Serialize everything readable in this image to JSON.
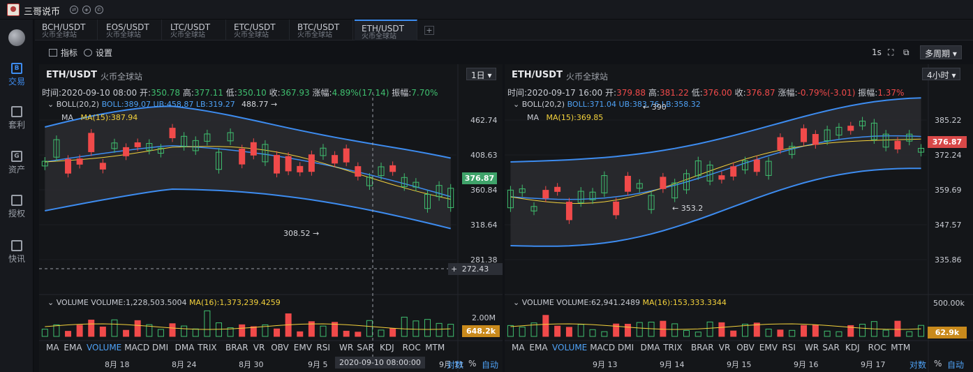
{
  "app": {
    "title": "三哥说币"
  },
  "sidebar": {
    "items": [
      {
        "label": "交易",
        "glyph": "B",
        "active": true
      },
      {
        "label": "套利",
        "glyph": "",
        "active": false
      },
      {
        "label": "资产",
        "glyph": "G",
        "active": false
      },
      {
        "label": "授权",
        "glyph": "",
        "active": false
      },
      {
        "label": "快讯",
        "glyph": "",
        "active": false
      }
    ]
  },
  "tabs": [
    {
      "name": "BCH/USDT",
      "sub": "火币全球站"
    },
    {
      "name": "EOS/USDT",
      "sub": "火币全球站"
    },
    {
      "name": "LTC/USDT",
      "sub": "火币全球站"
    },
    {
      "name": "ETC/USDT",
      "sub": "火币全球站"
    },
    {
      "name": "BTC/USDT",
      "sub": "火币全球站"
    },
    {
      "name": "ETH/USDT",
      "sub": "火币全球站",
      "active": true
    }
  ],
  "toolbar": {
    "indicators": "指标",
    "settings": "设置",
    "interval": "1s",
    "multi_period": "多周期"
  },
  "colors": {
    "up": "#3fbf6f",
    "down": "#f04a4a",
    "boll": "#4ea1f5",
    "ma": "#f4d23c",
    "accent": "#3d8cf0"
  },
  "left": {
    "symbol": "ETH/USDT",
    "exchange": "火币全球站",
    "period": "1日",
    "ohlc": {
      "time_label": "时间:",
      "time": "2020-09-10 08:00",
      "open_label": "开:",
      "open": "350.78",
      "high_label": "高:",
      "high": "377.11",
      "low_label": "低:",
      "low": "350.10",
      "close_label": "收:",
      "close": "367.93",
      "chg_label": "涨幅:",
      "chg": "4.89%(17.14)",
      "amp_label": "振幅:",
      "amp": "7.70%"
    },
    "boll": {
      "name": "BOLL(20,2)",
      "mid": "BOLL:389.07",
      "ub": "UB:458.87",
      "lb": "LB:319.27"
    },
    "ma": {
      "name": "MA",
      "value": "MA(15):387.94"
    },
    "volume": {
      "name": "VOLUME",
      "value": "VOLUME:1,228,503.5004",
      "ma": "MA(16):1,373,239.4259"
    },
    "yaxis": [
      "462.74",
      "408.63",
      "360.84",
      "318.64",
      "281.38"
    ],
    "price_tag": "376.87",
    "crosshair_tag": "272.43",
    "vol_axis": "2.00M",
    "vol_tag": "648.2k",
    "high_mark": "488.77",
    "low_mark": "308.52",
    "xaxis": [
      "8月 18",
      "8月 24",
      "8月 30",
      "9月 5",
      "9月 11"
    ],
    "hover_date": "2020-09-10 08:00:00",
    "axis_ctrl": [
      "对数",
      "%",
      "自动"
    ]
  },
  "right": {
    "symbol": "ETH/USDT",
    "exchange": "火币全球站",
    "period": "4小时",
    "ohlc": {
      "time_label": "时间:",
      "time": "2020-09-17 16:00",
      "open_label": "开:",
      "open": "379.88",
      "high_label": "高:",
      "high": "381.22",
      "low_label": "低:",
      "low": "376.00",
      "close_label": "收:",
      "close": "376.87",
      "chg_label": "涨幅:",
      "chg": "-0.79%(-3.01)",
      "amp_label": "振幅:",
      "amp": "1.37%"
    },
    "boll": {
      "name": "BOLL(20,2)",
      "mid": "BOLL:371.04",
      "ub": "UB:383.76",
      "lb": "LB:358.32"
    },
    "ma": {
      "name": "MA",
      "value": "MA(15):369.85"
    },
    "volume": {
      "name": "VOLUME",
      "value": "VOLUME:62,941.2489",
      "ma": "MA(16):153,333.3344"
    },
    "yaxis": [
      "385.22",
      "372.24",
      "359.69",
      "347.57",
      "335.86"
    ],
    "price_tag": "376.87",
    "vol_axis": "500.00k",
    "vol_tag": "62.9k",
    "high_mark": "390",
    "low_mark": "353.2",
    "xaxis": [
      "9月 13",
      "9月 14",
      "9月 15",
      "9月 16",
      "9月 17"
    ],
    "axis_ctrl": [
      "对数",
      "%",
      "自动"
    ]
  },
  "indicators": [
    "MA",
    "EMA",
    "VOLUME",
    "MACD",
    "DMI",
    "DMA",
    "TRIX",
    "BRAR",
    "VR",
    "OBV",
    "EMV",
    "RSI",
    "WR",
    "SAR",
    "KDJ",
    "ROC",
    "MTM"
  ],
  "active_indicator": "VOLUME"
}
